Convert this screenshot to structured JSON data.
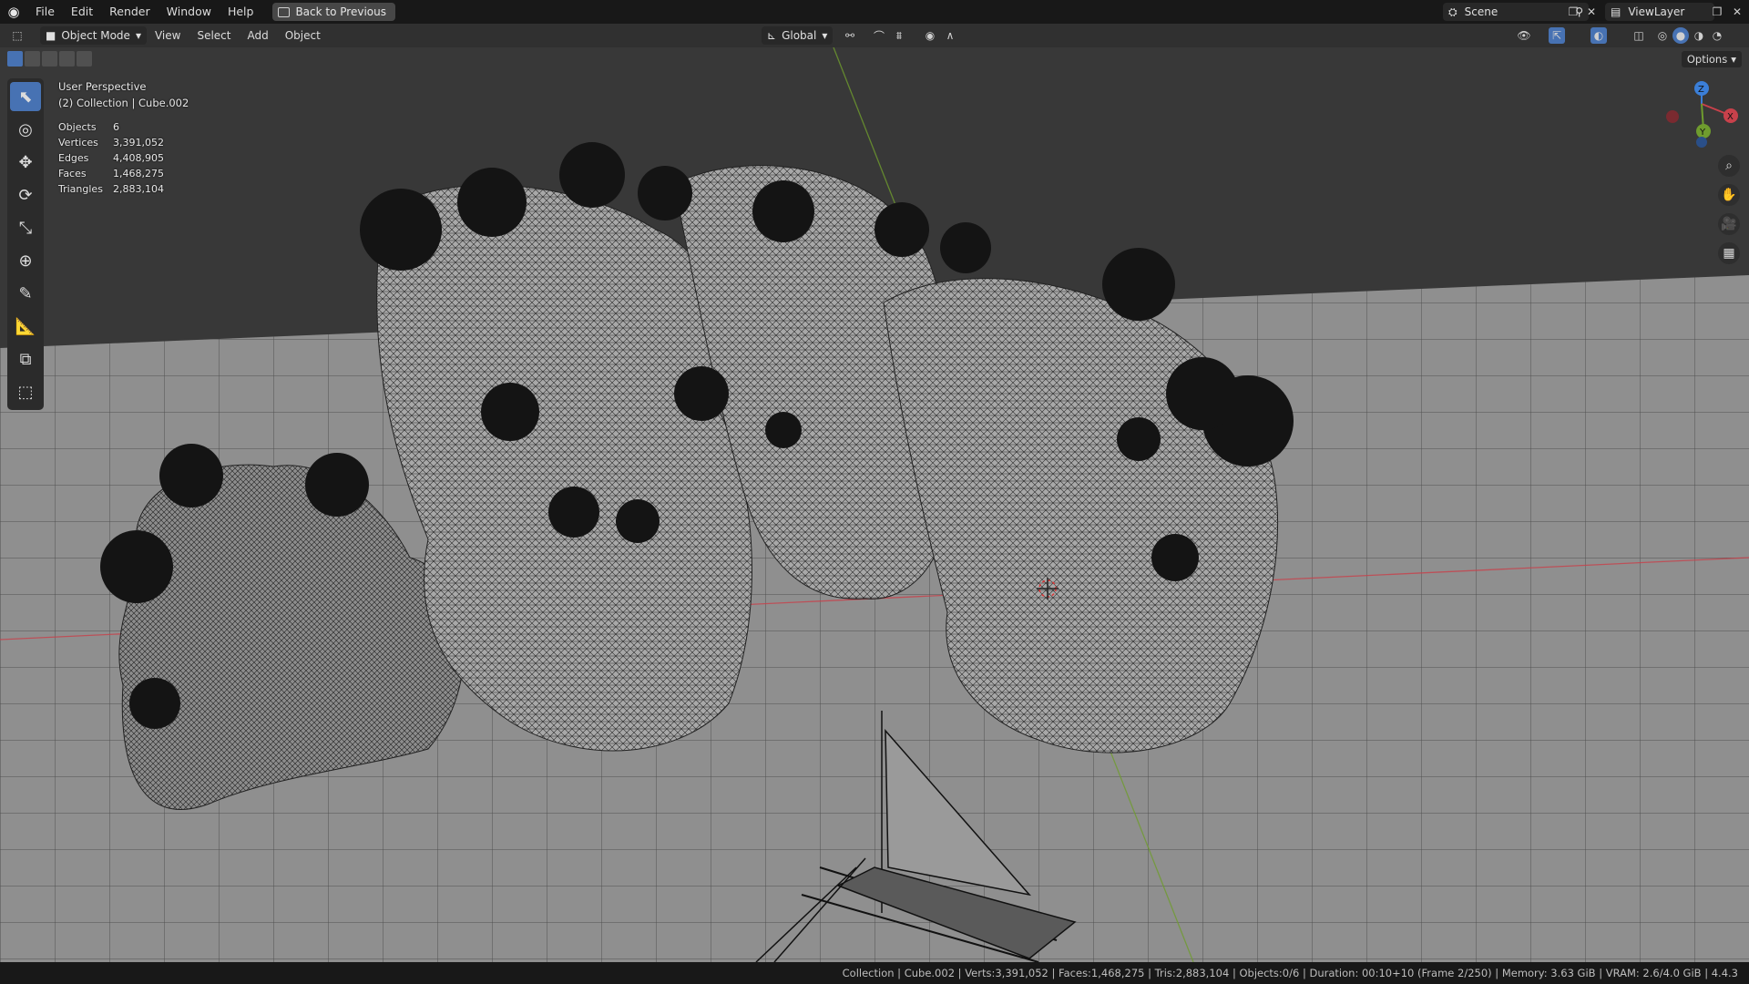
{
  "topbar": {
    "menus": [
      "File",
      "Edit",
      "Render",
      "Window",
      "Help"
    ],
    "back_label": "Back to Previous",
    "scene_label": "Scene",
    "viewlayer_label": "ViewLayer"
  },
  "header": {
    "mode_label": "Object Mode",
    "menus": [
      "View",
      "Select",
      "Add",
      "Object"
    ],
    "orientation_label": "Global"
  },
  "viewport": {
    "view_name": "User Perspective",
    "collection_line": "(2) Collection | Cube.002",
    "options_label": "Options",
    "stats": [
      {
        "label": "Objects",
        "value": "6"
      },
      {
        "label": "Vertices",
        "value": "3,391,052"
      },
      {
        "label": "Edges",
        "value": "4,408,905"
      },
      {
        "label": "Faces",
        "value": "1,468,275"
      },
      {
        "label": "Triangles",
        "value": "2,883,104"
      }
    ],
    "gizmo": {
      "z": "Z",
      "x": "X",
      "y": "Y"
    }
  },
  "statusbar": {
    "text": "Collection | Cube.002 | Verts:3,391,052 | Faces:1,468,275 | Tris:2,883,104 | Objects:0/6 | Duration: 00:10+10 (Frame 2/250) | Memory: 3.63 GiB | VRAM: 2.6/4.0 GiB | 4.4.3"
  },
  "colors": {
    "accent": "#4772b3",
    "grid_bg": "#3a3a3a",
    "axis_x": "#c8414b",
    "axis_y": "#6f9c2e",
    "axis_z": "#3b7fd8"
  }
}
